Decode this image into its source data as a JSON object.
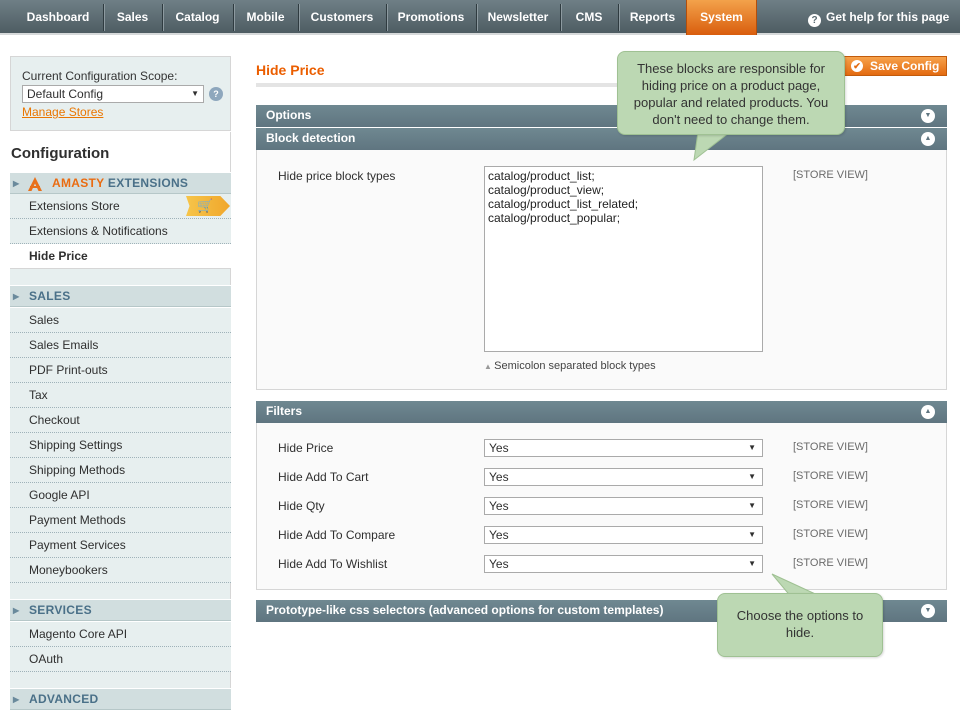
{
  "topnav": {
    "items": [
      "Dashboard",
      "Sales",
      "Catalog",
      "Mobile",
      "Customers",
      "Promotions",
      "Newsletter",
      "CMS",
      "Reports",
      "System"
    ],
    "help": "Get help for this page"
  },
  "sidebar": {
    "scope_label": "Current Configuration Scope:",
    "scope_value": "Default Config",
    "manage_stores": "Manage Stores",
    "title": "Configuration",
    "amasty": {
      "brand": "AMASTY",
      "label": "EXTENSIONS",
      "items": [
        "Extensions Store",
        "Extensions & Notifications",
        "Hide Price"
      ]
    },
    "sales": {
      "label": "SALES",
      "items": [
        "Sales",
        "Sales Emails",
        "PDF Print-outs",
        "Tax",
        "Checkout",
        "Shipping Settings",
        "Shipping Methods",
        "Google API",
        "Payment Methods",
        "Payment Services",
        "Moneybookers"
      ]
    },
    "services": {
      "label": "SERVICES",
      "items": [
        "Magento Core API",
        "OAuth"
      ]
    },
    "advanced": {
      "label": "ADVANCED"
    }
  },
  "main": {
    "title": "Hide Price",
    "save_label": "Save Config",
    "options_label": "Options",
    "block_detection": {
      "label": "Block detection",
      "field_label": "Hide price block types",
      "value": "catalog/product_list;\ncatalog/product_view;\ncatalog/product_list_related;\ncatalog/product_popular;",
      "scope": "[STORE VIEW]",
      "note": "Semicolon separated block types"
    },
    "filters": {
      "label": "Filters",
      "rows": [
        {
          "label": "Hide Price",
          "value": "Yes",
          "scope": "[STORE VIEW]"
        },
        {
          "label": "Hide Add To Cart",
          "value": "Yes",
          "scope": "[STORE VIEW]"
        },
        {
          "label": "Hide Qty",
          "value": "Yes",
          "scope": "[STORE VIEW]"
        },
        {
          "label": "Hide Add To Compare",
          "value": "Yes",
          "scope": "[STORE VIEW]"
        },
        {
          "label": "Hide Add To Wishlist",
          "value": "Yes",
          "scope": "[STORE VIEW]"
        }
      ]
    },
    "prototype_label": "Prototype-like css selectors (advanced options for custom templates)"
  },
  "callouts": {
    "top": "These blocks are responsible for hiding price on a product page, popular and related products. You don't need to change them.",
    "bottom": "Choose the options to hide."
  },
  "colors": {
    "accent": "#eb5e00",
    "section_header": "#5f7580",
    "callout": "#bcd8b3"
  }
}
